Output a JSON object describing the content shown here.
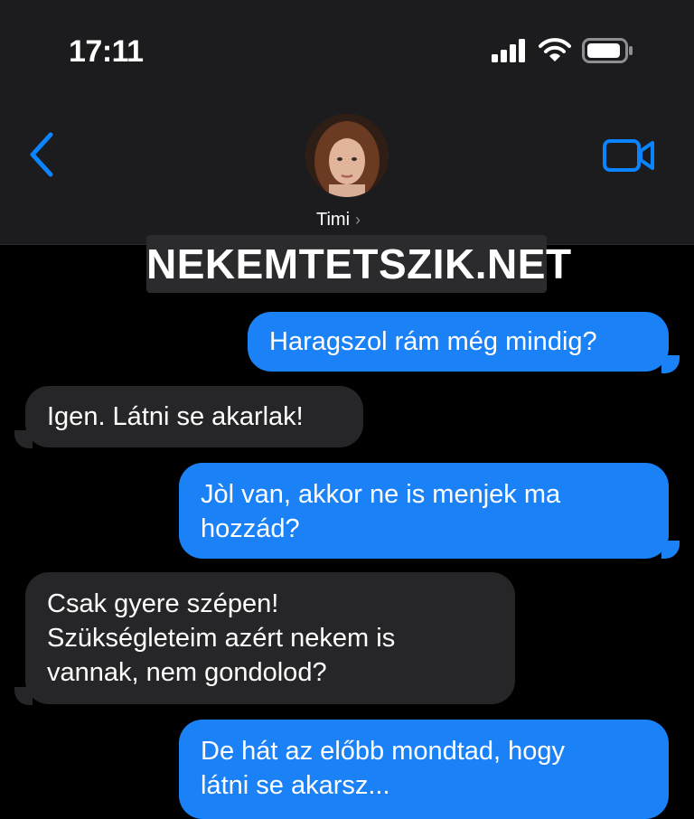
{
  "status_bar": {
    "time": "17:11",
    "icons": [
      "cellular-signal-icon",
      "wifi-icon",
      "battery-icon"
    ]
  },
  "header": {
    "contact_name": "Timi",
    "back_icon": "chevron-left-icon",
    "video_icon": "video-camera-icon",
    "avatar_icon": "contact-avatar"
  },
  "watermark": {
    "text": "NEKEMTETSZIK.NET"
  },
  "colors": {
    "header_bg": "#1c1c1e",
    "outgoing_bubble": "#1a81f7",
    "incoming_bubble": "#262628",
    "accent": "#0a84ff"
  },
  "messages": [
    {
      "direction": "outgoing",
      "text": "Haragszol rám még mindig?"
    },
    {
      "direction": "incoming",
      "text": "Igen. Látni se akarlak!"
    },
    {
      "direction": "outgoing",
      "lines": [
        "Jòl van, akkor ne is menjek ma",
        "hozzád?"
      ]
    },
    {
      "direction": "incoming",
      "lines": [
        "Csak gyere szépen!",
        "Szükségleteim azért nekem is",
        "vannak, nem gondolod?"
      ]
    },
    {
      "direction": "outgoing",
      "lines": [
        "De hát az előbb mondtad, hogy",
        "látni se akarsz..."
      ]
    }
  ]
}
